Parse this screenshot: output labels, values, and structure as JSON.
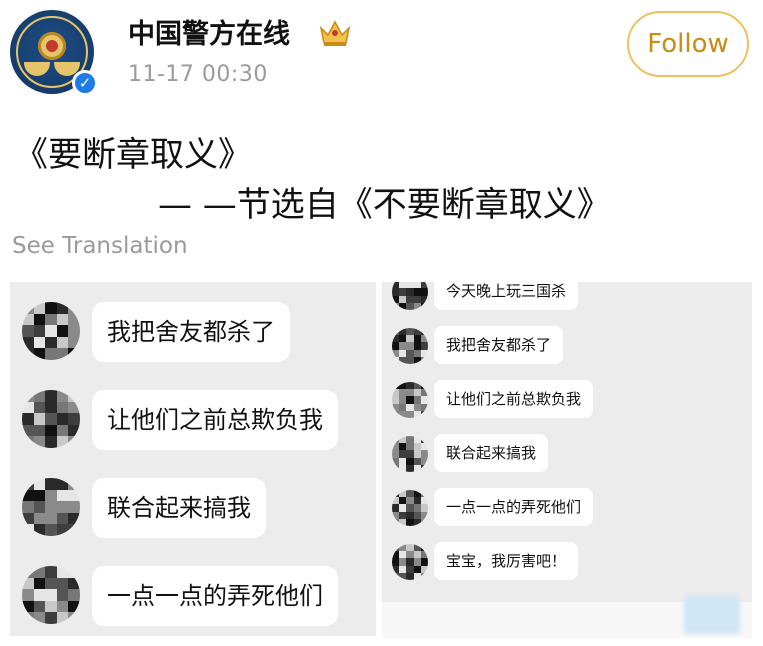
{
  "post": {
    "author": "中国警方在线",
    "timestamp": "11-17 00:30",
    "follow_label": "Follow",
    "avatar_text": "中国警方在线",
    "content_line1": "《要断章取义》",
    "content_line2": "— —节选自《不要断章取义》",
    "see_translation": "See Translation",
    "icons": [
      "police-emblem-avatar-icon",
      "verified-badge-icon",
      "crown-badge-icon"
    ],
    "colors": {
      "follow_border": "#f0c060",
      "follow_text": "#c98b12",
      "verified": "#1e7ce8",
      "muted": "#9a9a9a"
    }
  },
  "chat_left": {
    "messages": [
      "我把舍友都杀了",
      "让他们之前总欺负我",
      "联合起来搞我",
      "一点一点的弄死他们"
    ]
  },
  "chat_right": {
    "messages": [
      "今天晚上玩三国杀",
      "我把舍友都杀了",
      "让他们之前总欺负我",
      "联合起来搞我",
      "一点一点的弄死他们",
      "宝宝，我厉害吧！"
    ]
  }
}
